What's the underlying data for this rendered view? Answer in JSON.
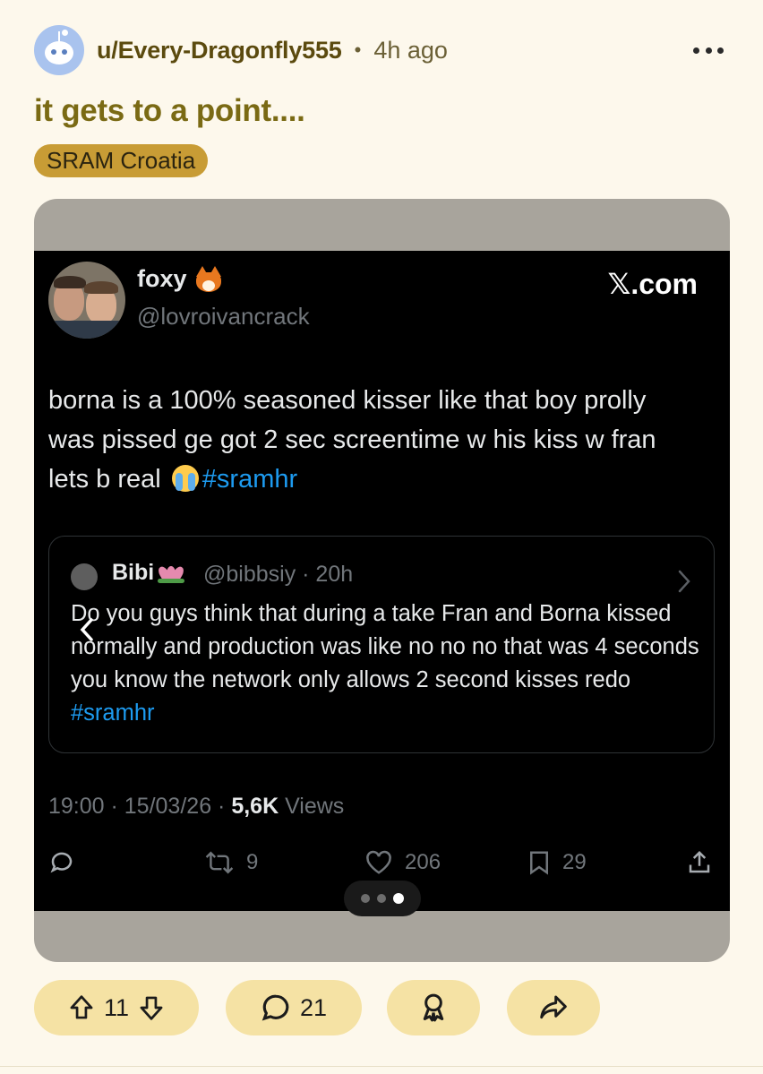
{
  "post": {
    "username": "u/Every-Dragonfly555",
    "separator": "•",
    "time_ago": "4h ago",
    "title": "it gets to a point....",
    "flair": "SRAM Croatia"
  },
  "tweet": {
    "name": "foxy",
    "handle": "@lovroivancrack",
    "source": "𝕏.com",
    "body_text": "borna is a 100% seasoned kisser like that boy prolly was pissed ge got 2 sec screentime w his kiss w fran lets b real ",
    "hashtag": "#sramhr",
    "quote": {
      "name": "Bibi",
      "meta": "@bibbsiy · 20h",
      "body_text": "Do you guys think that during a take Fran and Borna kissed normally and production was like no no no that was 4 seconds you know the network only allows 2 second kisses redo ",
      "hashtag": "#sramhr"
    },
    "timestamp": "19:00 · 15/03/26 · ",
    "views_count": "5,6K",
    "views_label": " Views",
    "actions": {
      "reposts": "9",
      "likes": "206",
      "bookmarks": "29"
    }
  },
  "carousel": {
    "total": 3,
    "active_index": 2
  },
  "actionbar": {
    "score": "11",
    "comments": "21"
  },
  "icons": {
    "more": "more-horizontal-icon",
    "reply": "speech-bubble-icon",
    "repost": "repost-arrows-icon",
    "like": "heart-icon",
    "bookmark": "bookmark-icon",
    "share": "share-upload-icon",
    "upvote": "arrow-up-icon",
    "downvote": "arrow-down-icon",
    "award": "award-icon",
    "post_share": "forward-arrow-icon"
  },
  "colors": {
    "background": "#fdf8ec",
    "username": "#5b4a0e",
    "title": "#7a6a14",
    "flair": "#c89c35",
    "pill": "#f5e2a4",
    "tweet_bg": "#000000",
    "hashtag": "#1d9bf0"
  }
}
